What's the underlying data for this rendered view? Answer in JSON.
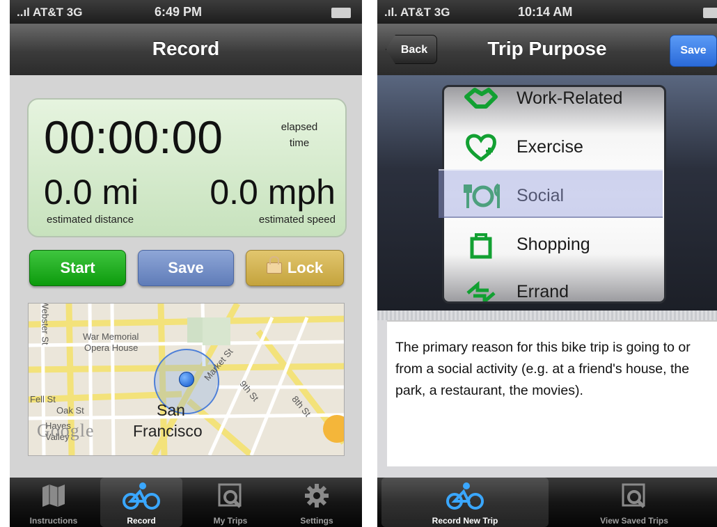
{
  "left": {
    "status": {
      "carrier": "..ıl AT&T  3G",
      "time": "6:49 PM"
    },
    "nav_title": "Record",
    "timer": {
      "elapsed": "00:00:00",
      "elapsed_label": "elapsed time",
      "distance": "0.0 mi",
      "distance_label": "estimated distance",
      "speed": "0.0 mph",
      "speed_label": "estimated speed"
    },
    "buttons": {
      "start": "Start",
      "save": "Save",
      "lock": "Lock"
    },
    "map": {
      "labels": [
        "War Memorial",
        "Opera House",
        "Fell St",
        "Oak St",
        "Hayes",
        "Valley",
        "Market St",
        "9th St",
        "8th St",
        "Webster St"
      ],
      "city_line1": "San",
      "city_line2": "Francisco",
      "logo": "Google"
    },
    "tabs": [
      {
        "label": "Instructions",
        "icon": "map-icon",
        "active": false
      },
      {
        "label": "Record",
        "icon": "bike-icon",
        "active": true
      },
      {
        "label": "My Trips",
        "icon": "trips-search-icon",
        "active": false
      },
      {
        "label": "Settings",
        "icon": "gear-icon",
        "active": false
      }
    ]
  },
  "right": {
    "status": {
      "carrier": ".ıl. AT&T  3G",
      "time": "10:14 AM"
    },
    "nav_title": "Trip Purpose",
    "back_label": "Back",
    "save_label": "Save",
    "picker_items": [
      {
        "label": "Work-Related",
        "icon": "handshake-icon"
      },
      {
        "label": "Exercise",
        "icon": "heart-plus-icon"
      },
      {
        "label": "Social",
        "icon": "fork-plate-knife-icon"
      },
      {
        "label": "Shopping",
        "icon": "shopping-bag-icon"
      },
      {
        "label": "Errand",
        "icon": "arrows-icon"
      }
    ],
    "selected": "Social",
    "description": "The primary reason for this bike trip is going to or from a social activity (e.g. at a friend's house, the park, a restaurant, the movies).",
    "tabs": [
      {
        "label": "Record New Trip",
        "icon": "bike-icon",
        "active": true
      },
      {
        "label": "View Saved Trips",
        "icon": "trips-search-icon",
        "active": false
      }
    ]
  },
  "colors": {
    "start": "#16a516",
    "save": "#6c88c6",
    "lock": "#d1b150",
    "icon_green": "#12a032",
    "nav_save": "#3b7ce8"
  }
}
